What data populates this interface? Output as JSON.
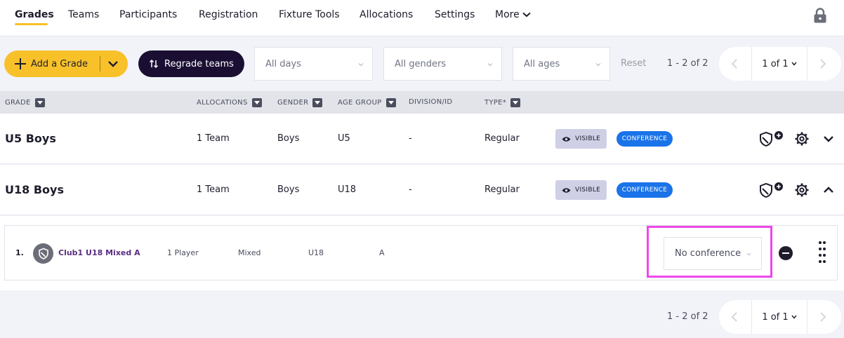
{
  "nav": {
    "items": [
      "Grades",
      "Teams",
      "Participants",
      "Registration",
      "Fixture Tools",
      "Allocations",
      "Settings"
    ],
    "more_label": "More"
  },
  "toolbar": {
    "add_grade_label": "Add a Grade",
    "regrade_label": "Regrade teams",
    "days_select": "All days",
    "genders_select": "All genders",
    "ages_select": "All ages",
    "reset_label": "Reset",
    "count_text": "1 - 2 of 2",
    "page_label": "1 of 1"
  },
  "table": {
    "headers": [
      "GRADE",
      "ALLOCATIONS",
      "GENDER",
      "AGE GROUP",
      "DIVISION/ID",
      "TYPE*"
    ],
    "rows": [
      {
        "name": "U5 Boys",
        "allocations": "1 Team",
        "gender": "Boys",
        "age_group": "U5",
        "division": "-",
        "type": "Regular",
        "visible_badge": "VISIBLE",
        "conference_badge": "CONFERENCE",
        "expanded": false
      },
      {
        "name": "U18 Boys",
        "allocations": "1 Team",
        "gender": "Boys",
        "age_group": "U18",
        "division": "-",
        "type": "Regular",
        "visible_badge": "VISIBLE",
        "conference_badge": "CONFERENCE",
        "expanded": true
      }
    ]
  },
  "team_entry": {
    "index": "1.",
    "name": "Club1 U18 Mixed A",
    "players": "1 Player",
    "gender": "Mixed",
    "age_group": "U18",
    "division": "A",
    "conference_select": "No conference"
  },
  "footer": {
    "count_text": "1 - 2 of 2",
    "page_label": "1 of 1"
  },
  "colors": {
    "accent_yellow": "#f8c12a",
    "dark_button": "#1a0f33",
    "conference_blue": "#1a73e8",
    "visible_badge": "#cfcfe6",
    "highlight_magenta": "#ee48ea",
    "team_name_purple": "#5a2d82"
  }
}
